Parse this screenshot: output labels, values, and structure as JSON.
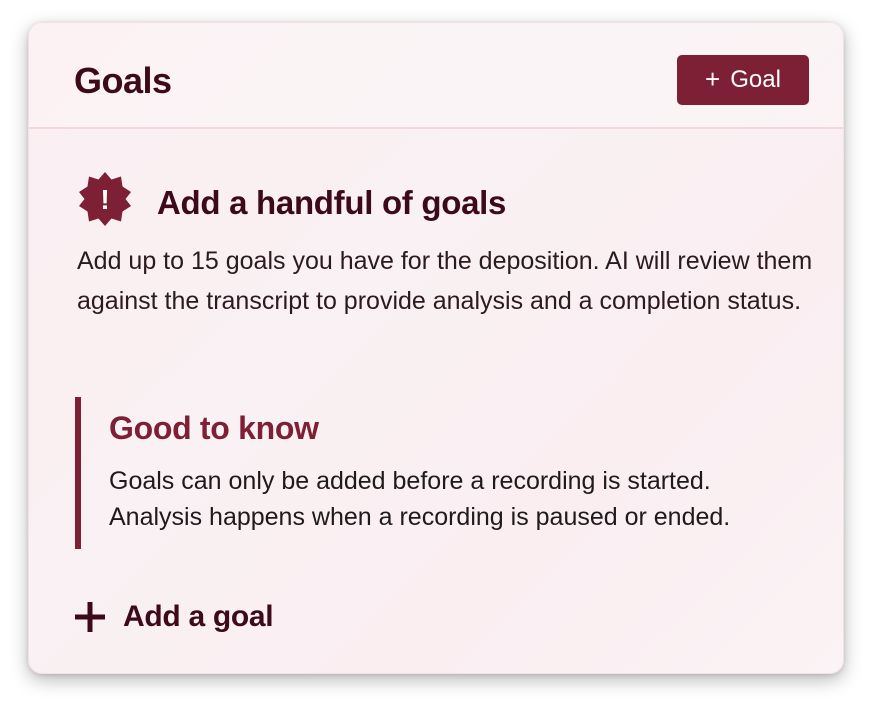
{
  "header": {
    "title": "Goals",
    "add_button_icon": "plus-icon",
    "add_button_label": "Goal"
  },
  "intro": {
    "icon": "alert-badge-icon",
    "icon_glyph": "!",
    "heading": "Add a handful of goals",
    "description": "Add up to 15 goals you have for the deposition. AI will review them against the transcript to provide analysis and a completion status."
  },
  "callout": {
    "title": "Good to know",
    "body_line1": "Goals can only be added before a recording is started.",
    "body_line2": "Analysis happens when a recording is paused or ended."
  },
  "footer": {
    "add_goal_icon": "plus-icon",
    "add_goal_label": "Add a goal"
  },
  "colors": {
    "brand": "#7d1f35",
    "heading_text": "#3d0a1c",
    "card_background": "#fbeef1"
  }
}
